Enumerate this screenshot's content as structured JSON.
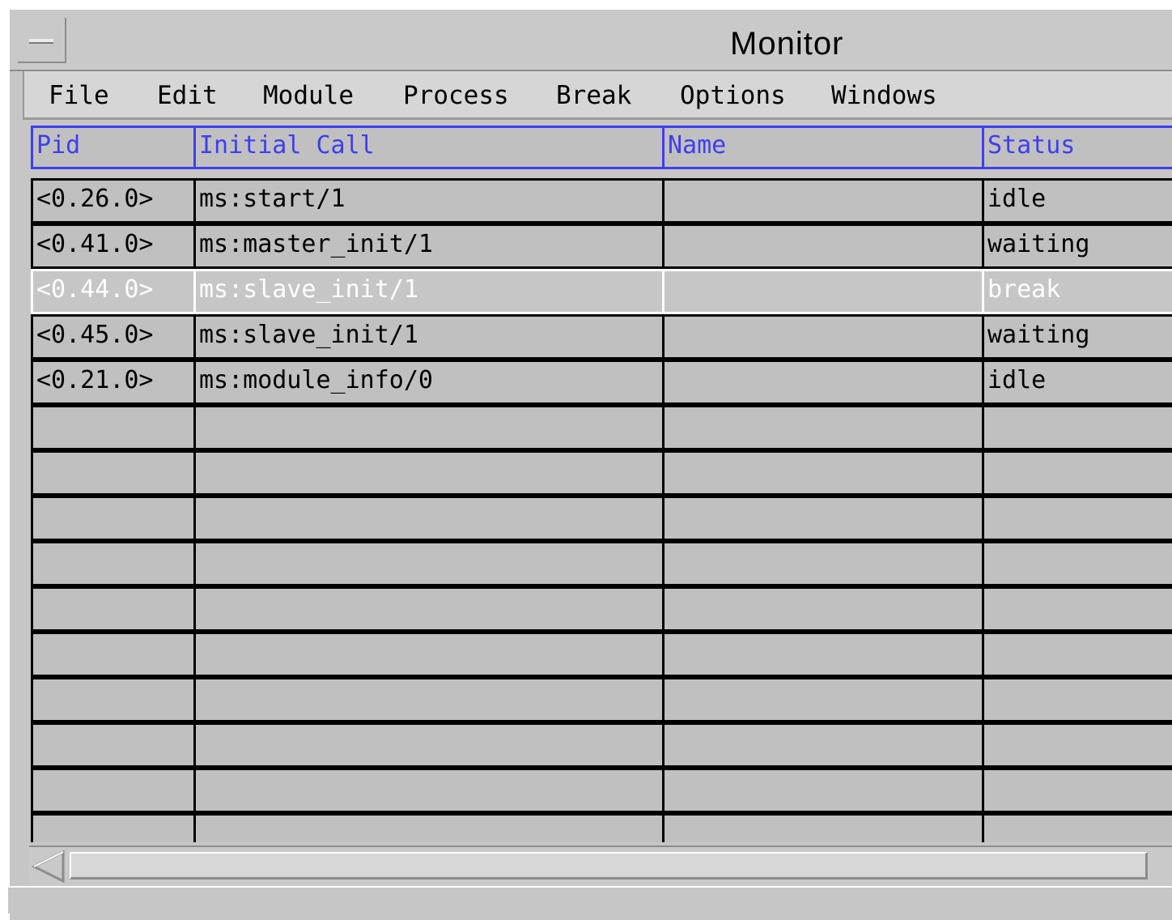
{
  "window": {
    "title": "Monitor"
  },
  "menu": [
    "File",
    "Edit",
    "Module",
    "Process",
    "Break",
    "Options",
    "Windows"
  ],
  "table": {
    "columns": [
      "Pid",
      "Initial Call",
      "Name",
      "Status"
    ],
    "rows": [
      {
        "pid": "<0.26.0>",
        "initial_call": "ms:start/1",
        "name": "",
        "status": "idle",
        "selected": false
      },
      {
        "pid": "<0.41.0>",
        "initial_call": "ms:master_init/1",
        "name": "",
        "status": "waiting",
        "selected": false
      },
      {
        "pid": "<0.44.0>",
        "initial_call": "ms:slave_init/1",
        "name": "",
        "status": "break",
        "selected": true
      },
      {
        "pid": "<0.45.0>",
        "initial_call": "ms:slave_init/1",
        "name": "",
        "status": "waiting",
        "selected": false
      },
      {
        "pid": "<0.21.0>",
        "initial_call": "ms:module_info/0",
        "name": "",
        "status": "idle",
        "selected": false
      }
    ],
    "empty_rows_visible": 10
  },
  "icons": {
    "window_menu": "window-menu-icon",
    "scroll_left": "scroll-left-arrow-icon"
  },
  "colors": {
    "header_blue": "#3e3ef0",
    "cell_bg": "#c0c0c0",
    "selection": "#ffffff"
  }
}
